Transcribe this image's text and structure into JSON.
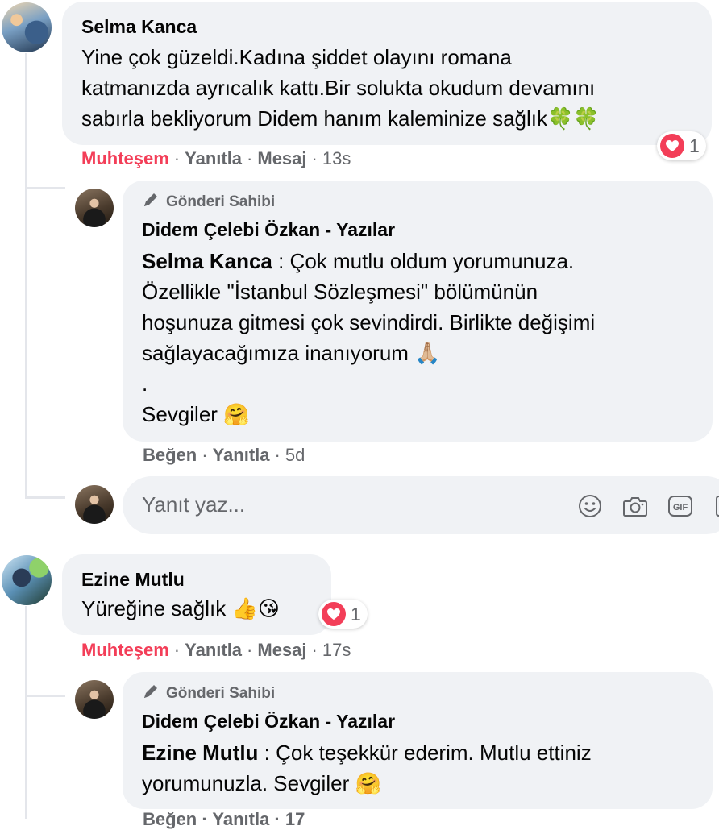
{
  "comments": [
    {
      "author": "Selma Kanca",
      "text_lines": [
        "Yine çok güzeldi.Kadına şiddet olayını romana",
        "katmanızda ayrıcalık kattı.Bir solukta okudum devamını",
        "sabırla bekliyorum Didem hanım kaleminize sağlık"
      ],
      "emoji": "🍀🍀",
      "reaction_count": "1",
      "actions": {
        "reaction": "Muhteşem",
        "reply": "Yanıtla",
        "message": "Mesaj",
        "time": "13s"
      },
      "reply": {
        "tag": "Gönderi Sahibi",
        "author": "Didem Çelebi Özkan - Yazılar",
        "mention": "Selma Kanca",
        "first_line_rest": " : Çok mutlu oldum yorumunuza.",
        "lines": [
          "Özellikle \"İstanbul Sözleşmesi\" bölümünün",
          "hoşunuza gitmesi çok sevindirdi. Birlikte değişimi",
          "sağlayacağımıza inanıyorum"
        ],
        "line3_emoji": "🙏🏼",
        "dot_line": ".",
        "sign_off": "Sevgiler",
        "sign_off_emoji": "🤗",
        "actions": {
          "like": "Beğen",
          "reply": "Yanıtla",
          "time": "5d"
        }
      }
    },
    {
      "author": "Ezine Mutlu",
      "text": "Yüreğine sağlık",
      "emoji": "👍😘",
      "reaction_count": "1",
      "actions": {
        "reaction": "Muhteşem",
        "reply": "Yanıtla",
        "message": "Mesaj",
        "time": "17s"
      },
      "reply": {
        "tag": "Gönderi Sahibi",
        "author": "Didem Çelebi Özkan - Yazılar",
        "mention": "Ezine Mutlu",
        "first_line_rest": " : Çok teşekkür ederim. Mutlu ettiniz",
        "line2": "yorumunuzla. Sevgiler",
        "line2_emoji": "🤗",
        "actions_partial": "Beğen · Yanıtla · 17"
      }
    }
  ],
  "reply_box": {
    "placeholder": "Yanıt yaz..."
  },
  "colors": {
    "bubble": "#f0f2f5",
    "love": "#f33e58",
    "muted": "#65676b",
    "thread_line": "#e4e6eb"
  }
}
